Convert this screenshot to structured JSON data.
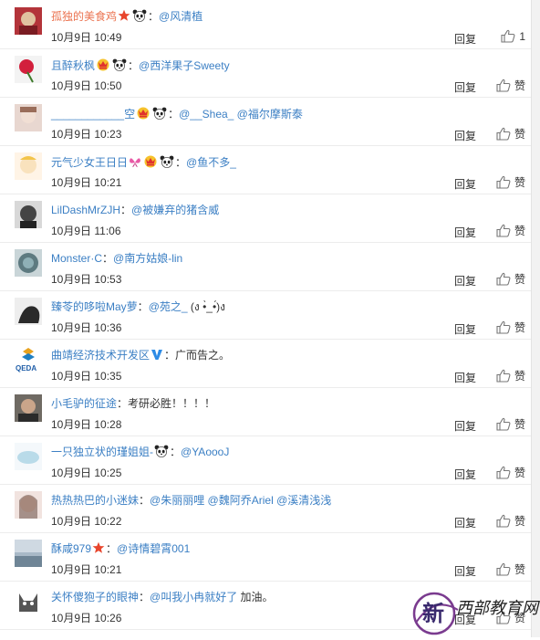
{
  "comments": [
    {
      "user": "孤独的美食鸡",
      "user_color": "orange",
      "badges": [
        "star",
        "panda"
      ],
      "colon": "：",
      "mention": "@风清植",
      "text": "",
      "time": "10月9日 10:49",
      "reply": "回复",
      "like": "1"
    },
    {
      "user": "且醉秋枫",
      "user_color": "blue",
      "badges": [
        "vip",
        "panda"
      ],
      "colon": "：",
      "mention": "@西洋果子Sweety",
      "text": "",
      "time": "10月9日 10:50",
      "reply": "回复",
      "like": "赞"
    },
    {
      "user": "____________空",
      "user_color": "blue",
      "badges": [
        "vip",
        "panda"
      ],
      "colon": "：",
      "mention": "@__Shea_ @福尔摩斯泰",
      "text": "",
      "time": "10月9日 10:23",
      "reply": "回复",
      "like": "赞"
    },
    {
      "user": "元气少女王日日",
      "user_color": "blue",
      "badges": [
        "butterfly",
        "vip",
        "panda"
      ],
      "colon": "：",
      "mention": "@鱼不多_",
      "text": "",
      "time": "10月9日 10:21",
      "reply": "回复",
      "like": "赞"
    },
    {
      "user": "LilDashMrZJH",
      "user_color": "blue",
      "badges": [],
      "colon": "：",
      "mention": "@被嫌弃的猪含威",
      "text": "",
      "time": "10月9日 11:06",
      "reply": "回复",
      "like": "赞"
    },
    {
      "user": "Monster·C",
      "user_color": "blue",
      "badges": [],
      "colon": "：",
      "mention": "@南方姑娘-lin",
      "text": "",
      "time": "10月9日 10:53",
      "reply": "回复",
      "like": "赞"
    },
    {
      "user": "臻苓的哆啦May萝",
      "user_color": "blue",
      "badges": [],
      "colon": "：",
      "mention": "@苑之_",
      "text": " (ง •̀_•́)ง",
      "time": "10月9日 10:36",
      "reply": "回复",
      "like": "赞"
    },
    {
      "user": "曲靖经济技术开发区",
      "user_color": "blue",
      "badges": [
        "verified"
      ],
      "colon": "：",
      "mention": "",
      "text": "广而告之。",
      "time": "10月9日 10:35",
      "reply": "回复",
      "like": "赞"
    },
    {
      "user": "小毛驴的征途",
      "user_color": "blue",
      "badges": [],
      "colon": "：",
      "mention": "",
      "text": "考研必胜！！！！",
      "time": "10月9日 10:28",
      "reply": "回复",
      "like": "赞"
    },
    {
      "user": "一只独立状的瑾姐姐-",
      "user_color": "blue",
      "badges": [
        "panda"
      ],
      "colon": "：",
      "mention": "@YAoooJ",
      "text": "",
      "time": "10月9日 10:25",
      "reply": "回复",
      "like": "赞"
    },
    {
      "user": "热热热巴的小迷妹",
      "user_color": "blue",
      "badges": [],
      "colon": "：",
      "mention": "@朱丽丽哩 @魏阿乔Ariel @溪清浅浅",
      "text": "",
      "time": "10月9日 10:22",
      "reply": "回复",
      "like": "赞"
    },
    {
      "user": "酥咸979",
      "user_color": "blue",
      "badges": [
        "star"
      ],
      "colon": "：",
      "mention": "@诗情碧霄001",
      "text": "",
      "time": "10月9日 10:21",
      "reply": "回复",
      "like": "赞"
    },
    {
      "user": "关怀傻狍子的眼神",
      "user_color": "blue",
      "badges": [],
      "colon": "：",
      "mention": "@叫我小冉就好了",
      "text": " 加油。",
      "time": "10月9日 10:26",
      "reply": "回复",
      "like": "赞"
    }
  ],
  "colors": {
    "link": "#3b7fc4",
    "orange_user": "#eb7350",
    "text": "#333333",
    "divider": "#ececec",
    "star": "#e8452c",
    "verified": "#2e8ce6"
  },
  "watermark": {
    "logo_char": "新",
    "text": "西部教育网"
  }
}
